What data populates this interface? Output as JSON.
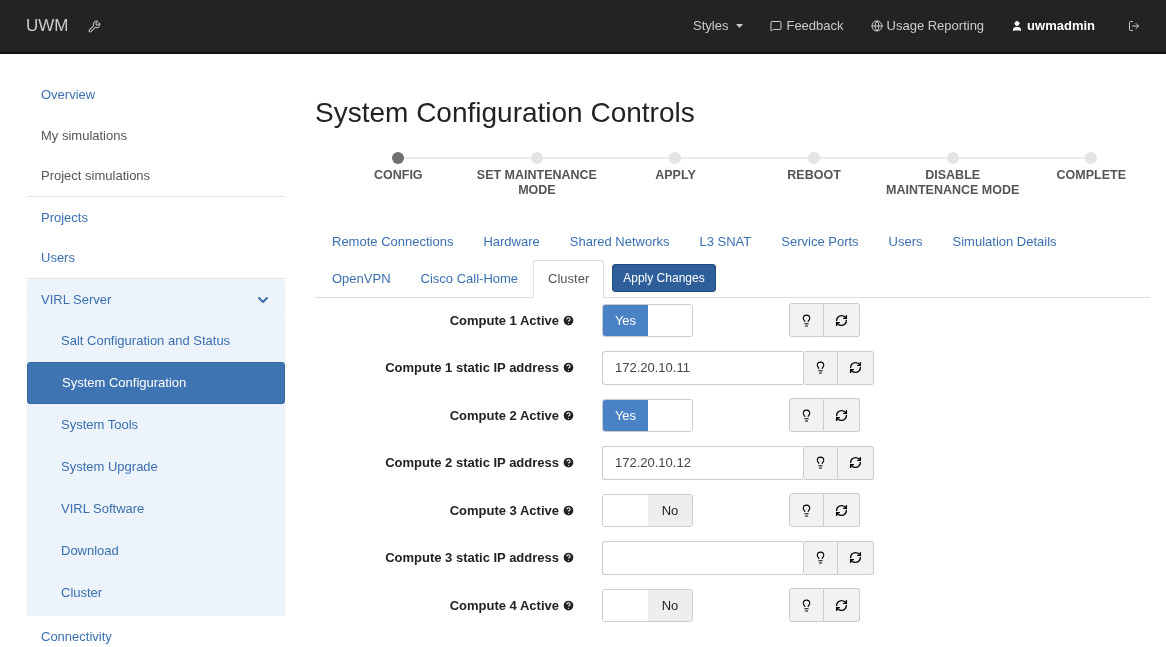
{
  "navbar": {
    "brand": "UWM",
    "links": [
      {
        "label": "Styles",
        "kind": "dropdown"
      },
      {
        "label": "Feedback",
        "kind": "comment"
      },
      {
        "label": "Usage Reporting",
        "kind": "globe"
      },
      {
        "label": "uwmadmin",
        "kind": "user"
      }
    ]
  },
  "sidebar": {
    "items": [
      {
        "label": "Overview",
        "selected": false,
        "muted": false,
        "divider": false
      },
      {
        "label": "My simulations",
        "selected": false,
        "muted": true,
        "divider": false
      },
      {
        "label": "Project simulations",
        "selected": false,
        "muted": true,
        "divider": true
      },
      {
        "label": "Projects",
        "selected": false,
        "muted": false,
        "divider": false
      },
      {
        "label": "Users",
        "selected": false,
        "muted": false,
        "divider": true
      },
      {
        "label": "VIRL Server",
        "selected": false,
        "muted": false,
        "divider": false,
        "expanded": true,
        "children": [
          {
            "label": "Salt Configuration and Status",
            "selected": false
          },
          {
            "label": "System Configuration",
            "selected": true
          },
          {
            "label": "System Tools",
            "selected": false
          },
          {
            "label": "System Upgrade",
            "selected": false
          },
          {
            "label": "VIRL Software",
            "selected": false
          },
          {
            "label": "Download",
            "selected": false
          },
          {
            "label": "Cluster",
            "selected": false
          }
        ]
      },
      {
        "label": "Connectivity",
        "selected": false,
        "muted": false,
        "divider": false
      }
    ]
  },
  "page_title": "System Configuration Controls",
  "steps": [
    {
      "label": "CONFIG",
      "selected": true
    },
    {
      "label": "SET MAINTENANCE MODE",
      "selected": false
    },
    {
      "label": "APPLY",
      "selected": false
    },
    {
      "label": "REBOOT",
      "selected": false
    },
    {
      "label": "DISABLE MAINTENANCE MODE",
      "selected": false
    },
    {
      "label": "COMPLETE",
      "selected": false
    }
  ],
  "tabs": [
    [
      {
        "label": "Remote Connections",
        "selected": false
      },
      {
        "label": "Hardware",
        "selected": false
      },
      {
        "label": "Shared Networks",
        "selected": false
      },
      {
        "label": "L3 SNAT",
        "selected": false
      },
      {
        "label": "Service Ports",
        "selected": false
      },
      {
        "label": "Users",
        "selected": false
      },
      {
        "label": "Simulation Details",
        "selected": false
      }
    ],
    [
      {
        "label": "OpenVPN",
        "selected": false
      },
      {
        "label": "Cisco Call-Home",
        "selected": false
      },
      {
        "label": "Cluster",
        "selected": true
      }
    ]
  ],
  "apply_button": "Apply Changes",
  "form": [
    {
      "kind": "toggle",
      "label": "Compute 1 Active",
      "on": true,
      "text": "Yes"
    },
    {
      "kind": "text",
      "label": "Compute 1 static IP address",
      "value": "172.20.10.11"
    },
    {
      "kind": "toggle",
      "label": "Compute 2 Active",
      "on": true,
      "text": "Yes"
    },
    {
      "kind": "text",
      "label": "Compute 2 static IP address",
      "value": "172.20.10.12"
    },
    {
      "kind": "toggle",
      "label": "Compute 3 Active",
      "on": false,
      "text": "No"
    },
    {
      "kind": "text",
      "label": "Compute 3 static IP address"
    },
    {
      "kind": "toggle",
      "label": "Compute 4 Active",
      "on": false,
      "text": "No"
    }
  ]
}
